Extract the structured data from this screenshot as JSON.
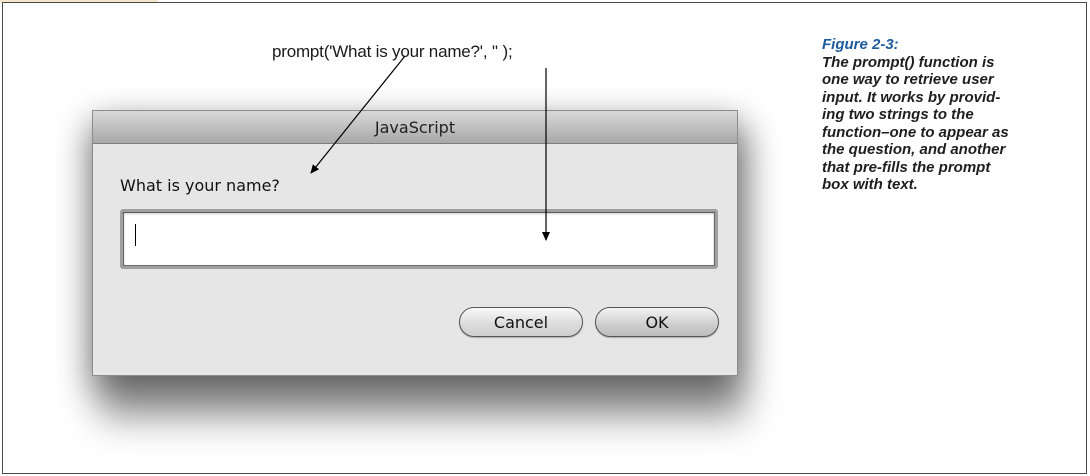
{
  "code_line": "prompt('What is your name?', '' );",
  "dialog": {
    "title": "JavaScript",
    "question": "What is your name?",
    "input_value": "",
    "cancel_label": "Cancel",
    "ok_label": "OK"
  },
  "caption": {
    "title": "Figure 2-3:",
    "lines": [
      "The prompt() function is",
      "one way to retrieve user",
      "input. It works by provid-",
      "ing two strings to the",
      "function–one to appear as",
      "the question, and another",
      "that pre-fills the prompt",
      "box with text."
    ]
  },
  "colors": {
    "caption_title": "#1d5aa0",
    "dialog_bg": "#e6e6e6"
  }
}
